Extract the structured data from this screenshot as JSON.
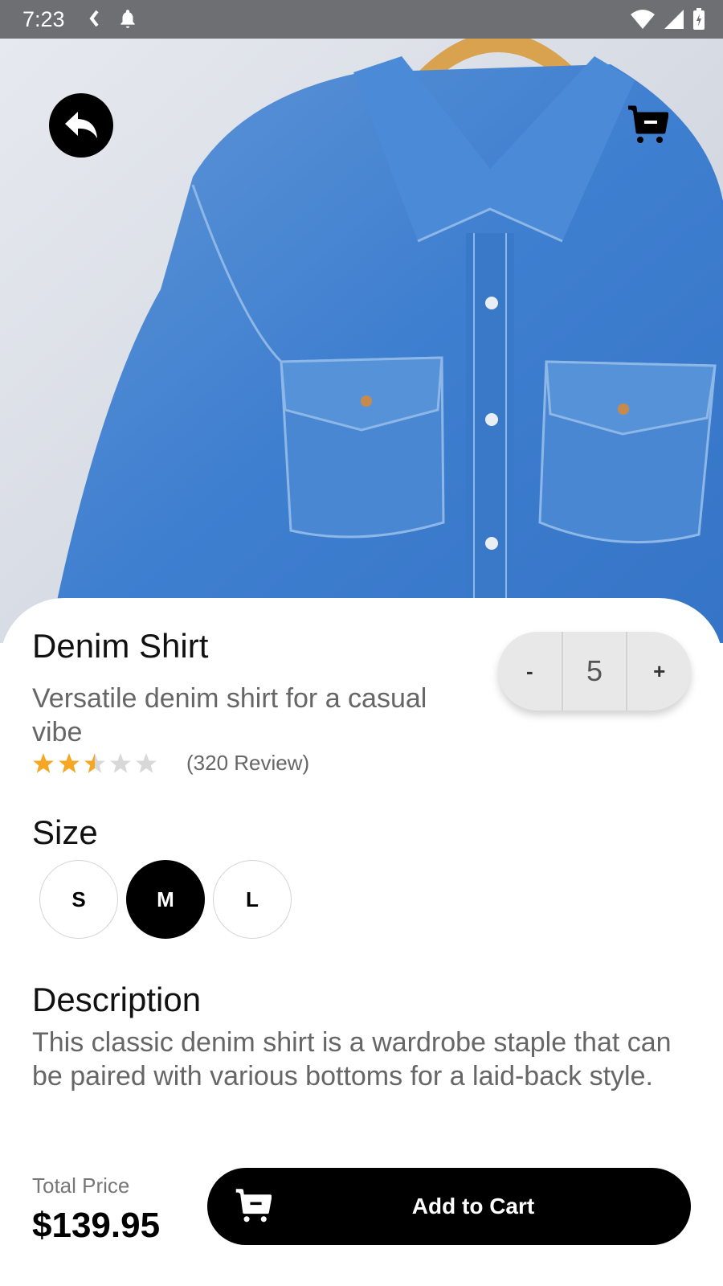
{
  "status": {
    "time": "7:23"
  },
  "product": {
    "title": "Denim Shirt",
    "subtitle": "Versatile denim shirt for a casual vibe",
    "rating": 2.5,
    "rating_max": 5,
    "reviews": "(320 Review)"
  },
  "quantity": {
    "minus": "-",
    "value": "5",
    "plus": "+"
  },
  "size": {
    "label": "Size",
    "options": [
      "S",
      "M",
      "L"
    ],
    "selected": "M"
  },
  "description": {
    "label": "Description",
    "text": "This classic denim shirt is a wardrobe staple that can be paired with various bottoms for a laid-back style."
  },
  "footer": {
    "total_label": "Total Price",
    "total_value": "$139.95",
    "add_to_cart": "Add to Cart"
  },
  "colors": {
    "accent": "#000000",
    "star": "#f5a623",
    "star_empty": "#d8d8d8"
  },
  "icons": [
    "back-icon",
    "cart-icon",
    "star-icon"
  ]
}
